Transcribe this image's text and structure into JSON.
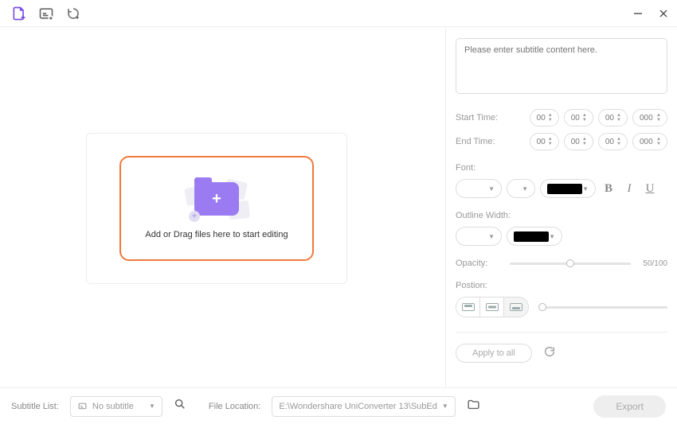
{
  "dropzone": {
    "text": "Add or Drag files here to start editing"
  },
  "subtitle": {
    "placeholder": "Please enter subtitle content here."
  },
  "time": {
    "start_label": "Start Time:",
    "end_label": "End Time:",
    "start": {
      "hh": "00",
      "mm": "00",
      "ss": "00",
      "ms": "000"
    },
    "end": {
      "hh": "00",
      "mm": "00",
      "ss": "00",
      "ms": "000"
    }
  },
  "font": {
    "label": "Font:",
    "family": "",
    "size": "",
    "color_hex": "#000000"
  },
  "outline": {
    "label": "Outline Width:",
    "width": "",
    "color_hex": "#000000"
  },
  "opacity": {
    "label": "Opacity:",
    "value": 50,
    "max": 100,
    "display": "50/100"
  },
  "position": {
    "label": "Postion:",
    "selected": "bottom"
  },
  "apply": {
    "label": "Apply to all"
  },
  "footer": {
    "subtitle_list_label": "Subtitle List:",
    "subtitle_list_value": "No subtitle",
    "file_location_label": "File Location:",
    "file_location_value": "E:\\Wondershare UniConverter 13\\SubEd",
    "export_label": "Export"
  }
}
